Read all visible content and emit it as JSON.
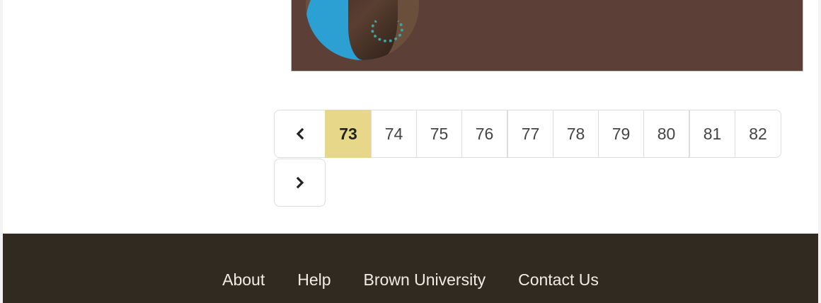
{
  "pagination": {
    "prev_icon": "chevron-left-icon",
    "next_icon": "chevron-right-icon",
    "pages": [
      "73",
      "74",
      "75",
      "76",
      "77",
      "78",
      "79",
      "80",
      "81",
      "82"
    ],
    "active_page": "73"
  },
  "footer": {
    "links": [
      "About",
      "Help",
      "Brown University",
      "Contact Us"
    ]
  },
  "colors": {
    "active_page_bg": "#e6d888",
    "footer_bg": "#302a21",
    "banner_bg": "#5c4038"
  }
}
